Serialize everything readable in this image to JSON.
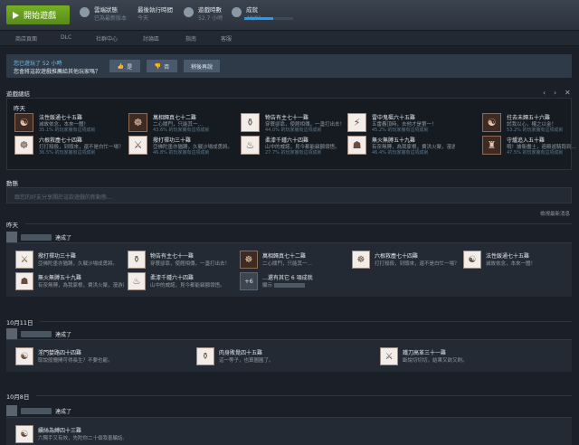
{
  "topbar": {
    "play_label": "開始遊戲",
    "stats": [
      {
        "label": "雲端狀態",
        "value": "已為最新版本"
      },
      {
        "label": "最後執行時間",
        "value": "今天"
      },
      {
        "label": "遊戲時數",
        "value": "52.7 小時"
      },
      {
        "label": "成就",
        "value": "48/81"
      }
    ],
    "achievement_progress": 0.59
  },
  "nav": [
    "商店頁面",
    "DLC",
    "社群中心",
    "討論區",
    "指南",
    "客服"
  ],
  "review": {
    "line1": "您已遊玩了 52 小時",
    "line2": "您會將這款遊戲推薦給其他玩家嗎？",
    "yes": "是",
    "no": "否",
    "later": "稍後再說"
  },
  "achievements_section": {
    "title": "遊戲總結",
    "group": "昨天",
    "items": [
      {
        "name": "法性飯通七十五難",
        "desc": "滅故依念，本來一體！",
        "pct": "35.1% 的玩家擁有這項成就",
        "icon": "☯",
        "light": false,
        "progress": 0.35
      },
      {
        "name": "萬相歸真七十二難",
        "desc": "二心關門，只能其一…",
        "pct": "43.6% 的玩家擁有這項成就",
        "icon": "☸",
        "light": false,
        "progress": 0.44
      },
      {
        "name": "物告有主七十一難",
        "desc": "穿蓑卻靠，使館相傳，一盞打出去！",
        "pct": "44.0% 的玩家擁有這項成就",
        "icon": "⚱",
        "light": true,
        "progress": 0.44
      },
      {
        "name": "雷中鬼樞六十五難",
        "desc": "五雷轟頂時，去他才是第一！",
        "pct": "45.2% 的玩家擁有這項成就",
        "icon": "⚡",
        "light": true,
        "progress": 0.45
      },
      {
        "name": "拄去未歸五十六難",
        "desc": "試我以心，權之以金！",
        "pct": "53.2% 的玩家擁有這項成就",
        "icon": "☯",
        "light": false,
        "progress": 0.53
      },
      {
        "name": "六根救塵七十四難",
        "desc": "打打殺殺，到頭來，還不是白忙一場？",
        "pct": "36.5% 的玩家擁有這項成就",
        "icon": "☸",
        "light": true,
        "progress": 0.37
      },
      {
        "name": "撥打禪功三十難",
        "desc": "亞佛陀墨亦猶踴，久戰沙場成勇將。",
        "pct": "46.8% 的玩家擁有這項成就",
        "icon": "⚔",
        "light": true,
        "progress": 0.47
      },
      {
        "name": "柔漆千鍾六十四難",
        "desc": "山中的威諾，見今都能竊額領悟。",
        "pct": "27.7% 的玩家擁有這項成就",
        "icon": "♨",
        "light": true,
        "progress": 0.28
      },
      {
        "name": "無火無膊五十九難",
        "desc": "有奈無膊，為我家根，費洪火聚，漫游道部。",
        "pct": "46.4% 的玩家擁有這項成就",
        "icon": "☗",
        "light": true,
        "progress": 0.46
      },
      {
        "name": "守爐追入五十難",
        "desc": "哦！爐衛盡土，造殿遊騎跑到…",
        "pct": "47.5% 的玩家擁有這項成就",
        "icon": "♜",
        "light": false,
        "progress": 0.48
      }
    ]
  },
  "activity": {
    "title": "動態",
    "placeholder": "跟您的好友分享關於這款遊戲的新動態…",
    "view_all": "檢視最新消息",
    "days": [
      {
        "date": "昨天",
        "action": "達成了",
        "items": [
          {
            "name": "撥打禪功三十難",
            "desc": "亞佛陀墨亦猶踴，久戰沙場成勇將。",
            "icon": "⚔",
            "dark": false
          },
          {
            "name": "物告有主七十一難",
            "desc": "穿蓑卻靠，使館相傳，一盞打出去！",
            "icon": "⚱",
            "dark": false
          },
          {
            "name": "萬相歸真七十二難",
            "desc": "二心關門，只能其一…",
            "icon": "☸",
            "dark": true
          },
          {
            "name": "六根救塵七十四難",
            "desc": "打打殺殺，到頭來，還不是白忙一場？",
            "icon": "☸",
            "dark": false
          },
          {
            "name": "法性飯通七十五難",
            "desc": "滅故依念，本來一體！",
            "icon": "☯",
            "dark": false
          },
          {
            "name": "無火無膊五十九難",
            "desc": "有奈無膊，為我家根，費洪火聚，漫游道部。",
            "icon": "☗",
            "dark": false
          },
          {
            "name": "柔漆千鍾六十四難",
            "desc": "山中的威諾，見今都能竊額領悟。",
            "icon": "♨",
            "dark": false
          }
        ],
        "more": {
          "badge": "+6",
          "text": "…還有其它 6 項成就",
          "sub": "顯示"
        }
      },
      {
        "date": "10月11日",
        "action": "達成了",
        "items": [
          {
            "name": "淫門婪路四十四難",
            "desc": "取說般攤開可得長生？不要也罷。",
            "icon": "☯",
            "dark": false
          },
          {
            "name": "肉身敗覺四十五難",
            "desc": "這一等子，也算圖圓了。",
            "icon": "⚱",
            "dark": false
          },
          {
            "name": "鐵刀高革三十一難",
            "desc": "斷說切切切，結果又欲又刷。",
            "icon": "⚔",
            "dark": false
          }
        ]
      },
      {
        "date": "10月8日",
        "action": "達成了",
        "items": [
          {
            "name": "續絲為縛四十三難",
            "desc": "六獨手又有效，先陀你二十個我善騙話。",
            "icon": "☯",
            "dark": false
          }
        ]
      }
    ]
  }
}
